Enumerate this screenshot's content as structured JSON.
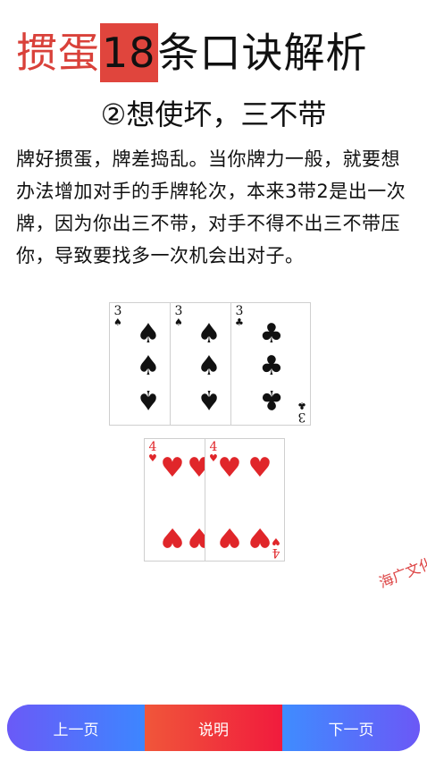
{
  "title": {
    "part1": "掼蛋",
    "badge": "18",
    "part2": "条口诀解析"
  },
  "subtitle": "②想使坏，三不带",
  "paragraph": "牌好掼蛋，牌差捣乱。当你牌力一般，就要想办法增加对手的手牌轮次，本来3带2是出一次牌，因为你出三不带，对手不得不出三不带压你，导致要找多一次机会出对子。",
  "cards_row1": [
    {
      "rank": "3",
      "suit": "♠",
      "color": "black"
    },
    {
      "rank": "3",
      "suit": "♠",
      "color": "black"
    },
    {
      "rank": "3",
      "suit": "♣",
      "color": "black"
    }
  ],
  "cards_row2": [
    {
      "rank": "4",
      "suit": "♥",
      "color": "red"
    },
    {
      "rank": "4",
      "suit": "♥",
      "color": "red"
    }
  ],
  "watermark": "海广文化",
  "bottom_nav": {
    "prev": "上一页",
    "help": "说明",
    "next": "下一页"
  },
  "colors": {
    "title_red": "#d9413a",
    "badge_bg": "#e0453d",
    "heart_red": "#e0262a"
  }
}
